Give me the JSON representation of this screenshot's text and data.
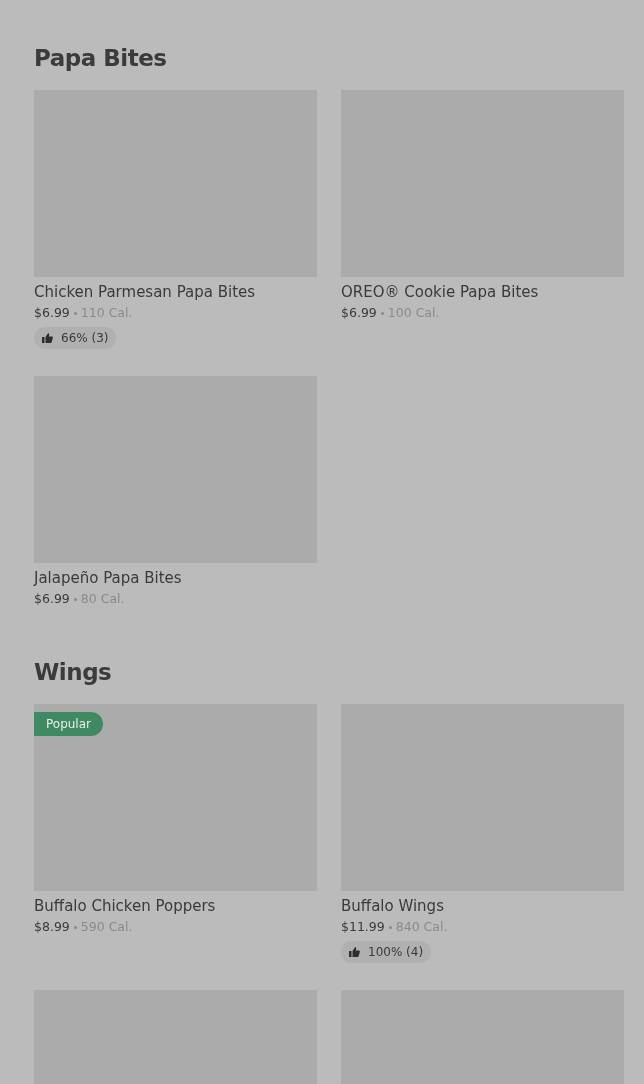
{
  "sections": [
    {
      "title": "Papa Bites",
      "items": [
        {
          "kind": "full",
          "name": "Chicken Parmesan Papa Bites",
          "price": "$6.99",
          "calories": "110 Cal.",
          "rating": "66% (3)"
        },
        {
          "kind": "full",
          "name": "OREO® Cookie Papa Bites",
          "price": "$6.99",
          "calories": "100 Cal."
        },
        {
          "kind": "full",
          "name": "Jalapeño Papa Bites",
          "price": "$6.99",
          "calories": "80 Cal."
        }
      ]
    },
    {
      "title": "Wings",
      "items": [
        {
          "kind": "full",
          "name": "Buffalo Chicken Poppers",
          "price": "$8.99",
          "calories": "590 Cal.",
          "badge": "Popular"
        },
        {
          "kind": "full",
          "name": "Buffalo Wings",
          "price": "$11.99",
          "calories": "840 Cal.",
          "rating": "100% (4)"
        },
        {
          "kind": "image_only"
        },
        {
          "kind": "image_only"
        }
      ]
    }
  ]
}
